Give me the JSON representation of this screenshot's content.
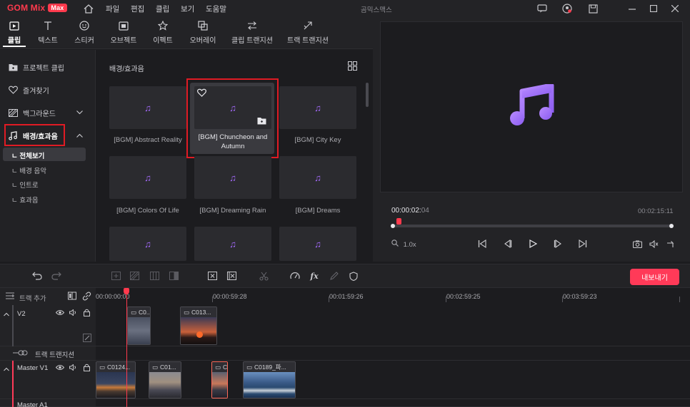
{
  "app": {
    "logo_text": "GOM Mix",
    "logo_badge": "Max",
    "window_title": "곰믹스맥스"
  },
  "menu": [
    "파일",
    "편집",
    "클립",
    "보기",
    "도움말"
  ],
  "tabs": [
    {
      "label": "클립",
      "icon": "clip-icon"
    },
    {
      "label": "텍스트",
      "icon": "text-icon"
    },
    {
      "label": "스티커",
      "icon": "sticker-icon"
    },
    {
      "label": "오브젝트",
      "icon": "object-icon"
    },
    {
      "label": "이펙트",
      "icon": "effect-icon"
    },
    {
      "label": "오버레이",
      "icon": "overlay-icon"
    },
    {
      "label": "클립 트랜지션",
      "icon": "clip-transition-icon"
    },
    {
      "label": "트랙 트랜지션",
      "icon": "track-transition-icon"
    }
  ],
  "sidebar": {
    "items": [
      {
        "label": "프로젝트 클립",
        "icon": "folder-icon"
      },
      {
        "label": "즐겨찾기",
        "icon": "heart-icon"
      },
      {
        "label": "백그라운드",
        "icon": "background-icon"
      },
      {
        "label": "배경/효과음",
        "icon": "music-note-icon"
      }
    ],
    "sub_items": [
      "전체보기",
      "배경 음악",
      "인트로",
      "효과음"
    ]
  },
  "content": {
    "title": "배경/효과음",
    "cards": [
      "[BGM] Abstract Reality",
      "[BGM] Chuncheon and Autumn",
      "[BGM] City Key",
      "[BGM] Colors Of Life",
      "[BGM] Dreaming Rain",
      "[BGM] Dreams",
      "",
      "",
      ""
    ]
  },
  "preview": {
    "timecode_main": "00:00:02:",
    "timecode_frames": "04",
    "duration": "00:02:15:11",
    "zoom": "1.0x",
    "playback_position": 0.015
  },
  "timeline": {
    "export_label": "내보내기",
    "add_track_label": "트랙 추가",
    "ruler_ticks": [
      "00:00:00:00",
      "00:00:59:28",
      "00:01:59:26",
      "00:02:59:25",
      "00:03:59:23"
    ],
    "tracks": {
      "v2": "V2",
      "transition": "트랙 트랜지션",
      "master_v1": "Master V1",
      "master_a1": "Master A1"
    },
    "clips": {
      "v2_a": "C0...",
      "v2_b": "C013...",
      "v1_a": "C0124...",
      "v1_b": "C01...",
      "v1_c": "C",
      "v1_d": "C0189_파..."
    }
  },
  "colors": {
    "accent": "#ff3a4d",
    "highlight_box": "#e01b24",
    "note_purple": "#a66bff"
  }
}
